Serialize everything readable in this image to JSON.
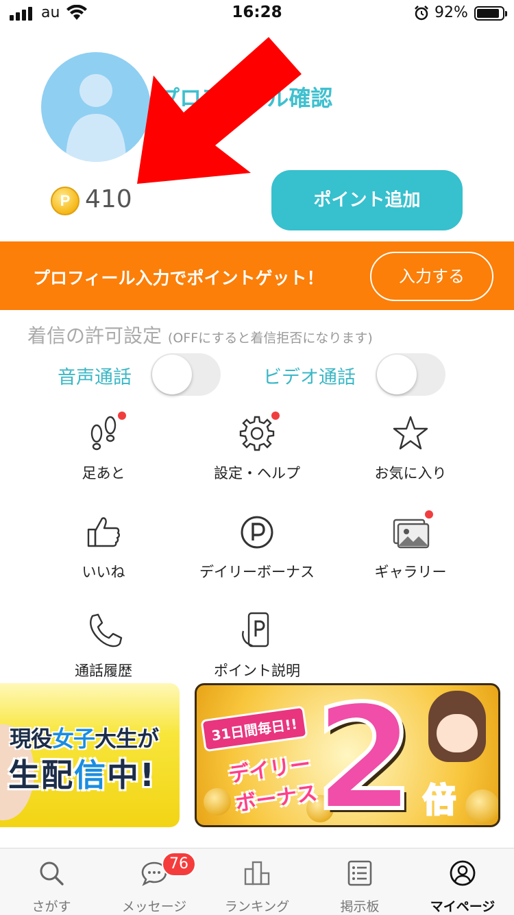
{
  "status_bar": {
    "carrier": "au",
    "time": "16:28",
    "battery_percent_text": "92%",
    "battery_level": 0.92
  },
  "profile": {
    "link_text": "プロフィール確認",
    "points": "410",
    "coin_symbol": "P",
    "add_points_label": "ポイント追加"
  },
  "promo": {
    "message": "プロフィール入力でポイントゲット！",
    "button_label": "入力する"
  },
  "call_settings": {
    "title": "着信の許可設定",
    "note": "(OFFにすると着信拒否になります)",
    "voice_label": "音声通話",
    "voice_enabled": false,
    "video_label": "ビデオ通話",
    "video_enabled": false
  },
  "menu": [
    {
      "label": "足あと",
      "icon": "footprints-icon",
      "dot": true
    },
    {
      "label": "設定・ヘルプ",
      "icon": "gear-icon",
      "dot": true
    },
    {
      "label": "お気に入り",
      "icon": "star-icon",
      "dot": false
    },
    {
      "label": "いいね",
      "icon": "thumbs-up-icon",
      "dot": false
    },
    {
      "label": "デイリーボーナス",
      "icon": "p-circle-icon",
      "dot": false
    },
    {
      "label": "ギャラリー",
      "icon": "gallery-icon",
      "dot": true
    },
    {
      "label": "通話履歴",
      "icon": "phone-icon",
      "dot": false
    },
    {
      "label": "ポイント説明",
      "icon": "phone-p-icon",
      "dot": false
    }
  ],
  "banners": {
    "left": {
      "line1_a": "現役",
      "line1_b": "女子",
      "line1_c": "大生",
      "line1_d": "が",
      "line2_a": "生配",
      "line2_b": "信",
      "line2_c": "中!"
    },
    "right": {
      "days": "31日間毎日!!",
      "daily_line1": "デイリー",
      "daily_line2": "ボーナス",
      "big": "2",
      "times": "倍"
    }
  },
  "tabbar": {
    "tabs": [
      {
        "label": "さがす",
        "icon": "search-icon"
      },
      {
        "label": "メッセージ",
        "icon": "chat-icon"
      },
      {
        "label": "ランキング",
        "icon": "ranking-icon"
      },
      {
        "label": "掲示板",
        "icon": "board-icon"
      },
      {
        "label": "マイページ",
        "icon": "user-circle-icon"
      }
    ],
    "message_badge": "76",
    "active_tab": "マイページ"
  },
  "colors": {
    "accent": "#37c0cd",
    "promo": "#fb7f09",
    "notify": "#f03e3e",
    "arrow": "#ff0000"
  }
}
